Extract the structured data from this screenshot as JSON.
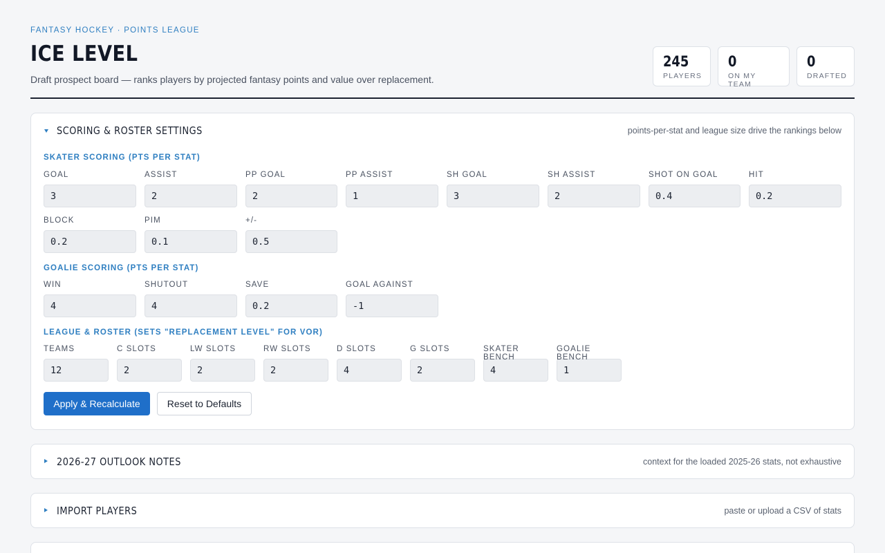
{
  "header": {
    "eyebrow": "FANTASY HOCKEY · POINTS LEAGUE",
    "title": "ICE LEVEL",
    "subtitle": "Draft prospect board — ranks players by projected fantasy points and value over replacement."
  },
  "stats": [
    {
      "value": "245",
      "label": "PLAYERS"
    },
    {
      "value": "0",
      "label": "ON MY TEAM"
    },
    {
      "value": "0",
      "label": "DRAFTED"
    }
  ],
  "scoring_panel": {
    "title": "SCORING & ROSTER SETTINGS",
    "note": "points-per-stat and league size drive the rankings below",
    "expanded": true,
    "skater": {
      "heading": "SKATER SCORING (PTS PER STAT)",
      "fields": [
        {
          "label": "GOAL",
          "value": "3"
        },
        {
          "label": "ASSIST",
          "value": "2"
        },
        {
          "label": "PP GOAL",
          "value": "2"
        },
        {
          "label": "PP ASSIST",
          "value": "1"
        },
        {
          "label": "SH GOAL",
          "value": "3"
        },
        {
          "label": "SH ASSIST",
          "value": "2"
        },
        {
          "label": "SHOT ON GOAL",
          "value": "0.4"
        },
        {
          "label": "HIT",
          "value": "0.2"
        },
        {
          "label": "BLOCK",
          "value": "0.2"
        },
        {
          "label": "PIM",
          "value": "0.1"
        },
        {
          "label": "+/-",
          "value": "0.5"
        }
      ]
    },
    "goalie": {
      "heading": "GOALIE SCORING (PTS PER STAT)",
      "fields": [
        {
          "label": "WIN",
          "value": "4"
        },
        {
          "label": "SHUTOUT",
          "value": "4"
        },
        {
          "label": "SAVE",
          "value": "0.2"
        },
        {
          "label": "GOAL AGAINST",
          "value": "-1"
        }
      ]
    },
    "league": {
      "heading": "LEAGUE & ROSTER (SETS \"REPLACEMENT LEVEL\" FOR VOR)",
      "fields": [
        {
          "label": "TEAMS",
          "value": "12"
        },
        {
          "label": "C SLOTS",
          "value": "2"
        },
        {
          "label": "LW SLOTS",
          "value": "2"
        },
        {
          "label": "RW SLOTS",
          "value": "2"
        },
        {
          "label": "D SLOTS",
          "value": "4"
        },
        {
          "label": "G SLOTS",
          "value": "2"
        },
        {
          "label": "SKATER BENCH",
          "value": "4"
        },
        {
          "label": "GOALIE BENCH",
          "value": "1"
        }
      ]
    },
    "apply_label": "Apply & Recalculate",
    "reset_label": "Reset to Defaults"
  },
  "outlook_panel": {
    "title": "2026-27 OUTLOOK NOTES",
    "note": "context for the loaded 2025-26 stats, not exhaustive",
    "expanded": false
  },
  "import_panel": {
    "title": "IMPORT PLAYERS",
    "note": "paste or upload a CSV of stats",
    "expanded": false
  },
  "colors": {
    "accent": "#2f7fc1",
    "primary_button": "#1f6fc9",
    "background": "#f5f6f8"
  }
}
